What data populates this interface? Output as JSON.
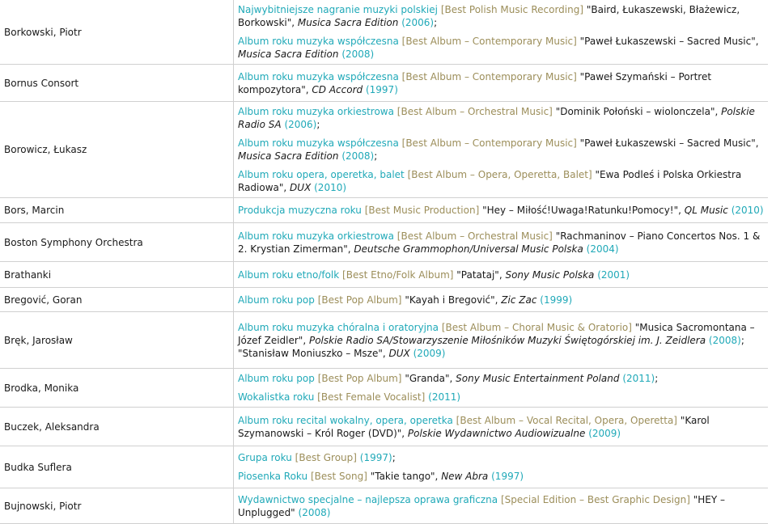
{
  "rows": [
    {
      "name": "Borkowski, Piotr",
      "entries": [
        {
          "cat": "Najwybitniejsze nagranie muzyki polskiej",
          "eng": "[Best Polish Music Recording]",
          "title": "\"Baird, Łukaszewski, Błażewicz, Borkowski\", ",
          "label": "Musica Sacra Edition",
          "year": "(2006)",
          "tail": ";"
        },
        {
          "cat": "Album roku muzyka współczesna",
          "eng": "[Best Album – Contemporary Music]",
          "title": "\"Paweł Łukaszewski – Sacred Music\", ",
          "label": "Musica Sacra Edition",
          "year": "(2008)",
          "tail": ""
        }
      ]
    },
    {
      "name": "Bornus Consort",
      "entries": [
        {
          "cat": "Album roku muzyka współczesna",
          "eng": "[Best Album – Contemporary Music]",
          "title": "\"Paweł Szymański – Portret kompozytora\", ",
          "label": "CD Accord",
          "year": "(1997)",
          "tail": ""
        }
      ]
    },
    {
      "name": "Borowicz, Łukasz",
      "entries": [
        {
          "cat": "Album roku muzyka orkiestrowa",
          "eng": "[Best Album – Orchestral Music]",
          "title": "\"Dominik Połoński – wiolonczela\", ",
          "label": "Polskie Radio SA",
          "year": "(2006)",
          "tail": ";"
        },
        {
          "cat": "Album roku muzyka współczesna",
          "eng": "[Best Album – Contemporary Music]",
          "title": "\"Paweł Łukaszewski – Sacred Music\", ",
          "label": "Musica Sacra Edition",
          "year": "(2008)",
          "tail": ";"
        },
        {
          "cat": "Album roku opera, operetka, balet",
          "eng": "[Best Album – Opera, Operetta, Balet]",
          "title": "\"Ewa Podleś i Polska Orkiestra Radiowa\", ",
          "label": "DUX",
          "year": "(2010)",
          "tail": ""
        }
      ]
    },
    {
      "name": "Bors, Marcin",
      "entries": [
        {
          "cat": "Produkcja muzyczna roku",
          "eng": "[Best Music Production]",
          "title": "\"Hey – Miłość!Uwaga!Ratunku!Pomocy!\", ",
          "label": "QL Music",
          "year": "(2010)",
          "tail": ""
        }
      ]
    },
    {
      "name": "Boston Symphony Orchestra",
      "entries": [
        {
          "cat": "Album roku muzyka orkiestrowa",
          "eng": "[Best Album – Orchestral Music]",
          "title": "\"Rachmaninov – Piano Concertos Nos. 1 & 2. Krystian Zimerman\", ",
          "label": "Deutsche Grammophon/Universal Music Polska",
          "year": "(2004)",
          "tail": ""
        }
      ]
    },
    {
      "name": "Brathanki",
      "entries": [
        {
          "cat": "Album roku etno/folk",
          "eng": "[Best Etno/Folk Album]",
          "title": "\"Patataj\", ",
          "label": "Sony Music Polska",
          "year": "(2001)",
          "tail": ""
        }
      ]
    },
    {
      "name": "Bregović, Goran",
      "entries": [
        {
          "cat": "Album roku pop",
          "eng": "[Best Pop Album]",
          "title": "\"Kayah i Bregović\", ",
          "label": "Zic Zac",
          "year": "(1999)",
          "tail": ""
        }
      ]
    },
    {
      "name": "Bręk, Jarosław",
      "entries": [
        {
          "cat": "Album roku muzyka chóralna i oratoryjna",
          "eng": "[Best Album – Choral Music & Oratorio]",
          "title": "\"Musica Sacromontana – Józef Zeidler\", ",
          "label": "Polskie Radio SA/Stowarzyszenie Miłośników Muzyki Świętogórskiej im. J. Zeidlera",
          "year": "(2008)",
          "tail": "; \"Stanisław Moniuszko – Msze\", ",
          "label2": "DUX",
          "year2": "(2009)"
        }
      ]
    },
    {
      "name": "Brodka, Monika",
      "entries": [
        {
          "cat": "Album roku pop",
          "eng": "[Best Pop Album]",
          "title": "\"Granda\", ",
          "label": "Sony Music Entertainment Poland",
          "year": "(2011)",
          "tail": ";"
        },
        {
          "cat": "Wokalistka roku",
          "eng": "[Best Female Vocalist]",
          "title": "",
          "label": "",
          "year": "(2011)",
          "tail": ""
        }
      ]
    },
    {
      "name": "Buczek, Aleksandra",
      "entries": [
        {
          "cat": "Album roku recital wokalny, opera, operetka",
          "eng": "[Best Album – Vocal Recital, Opera, Operetta]",
          "title": "\"Karol Szymanowski – Król Roger (DVD)\", ",
          "label": "Polskie Wydawnictwo Audiowizualne",
          "year": "(2009)",
          "tail": ""
        }
      ]
    },
    {
      "name": "Budka Suflera",
      "entries": [
        {
          "cat": "Grupa roku",
          "eng": "[Best Group]",
          "title": "",
          "label": "",
          "year": "(1997)",
          "tail": ";"
        },
        {
          "cat": "Piosenka Roku",
          "eng": "[Best Song]",
          "title": "\"Takie tango\", ",
          "label": "New Abra",
          "year": "(1997)",
          "tail": ""
        }
      ]
    },
    {
      "name": "Bujnowski, Piotr",
      "entries": [
        {
          "cat": "Wydawnictwo specjalne – najlepsza oprawa graficzna",
          "eng": "[Special Edition – Best Graphic Design]",
          "title": "\"HEY – Unplugged\" ",
          "label": "",
          "year": "(2008)",
          "tail": ""
        }
      ]
    }
  ]
}
